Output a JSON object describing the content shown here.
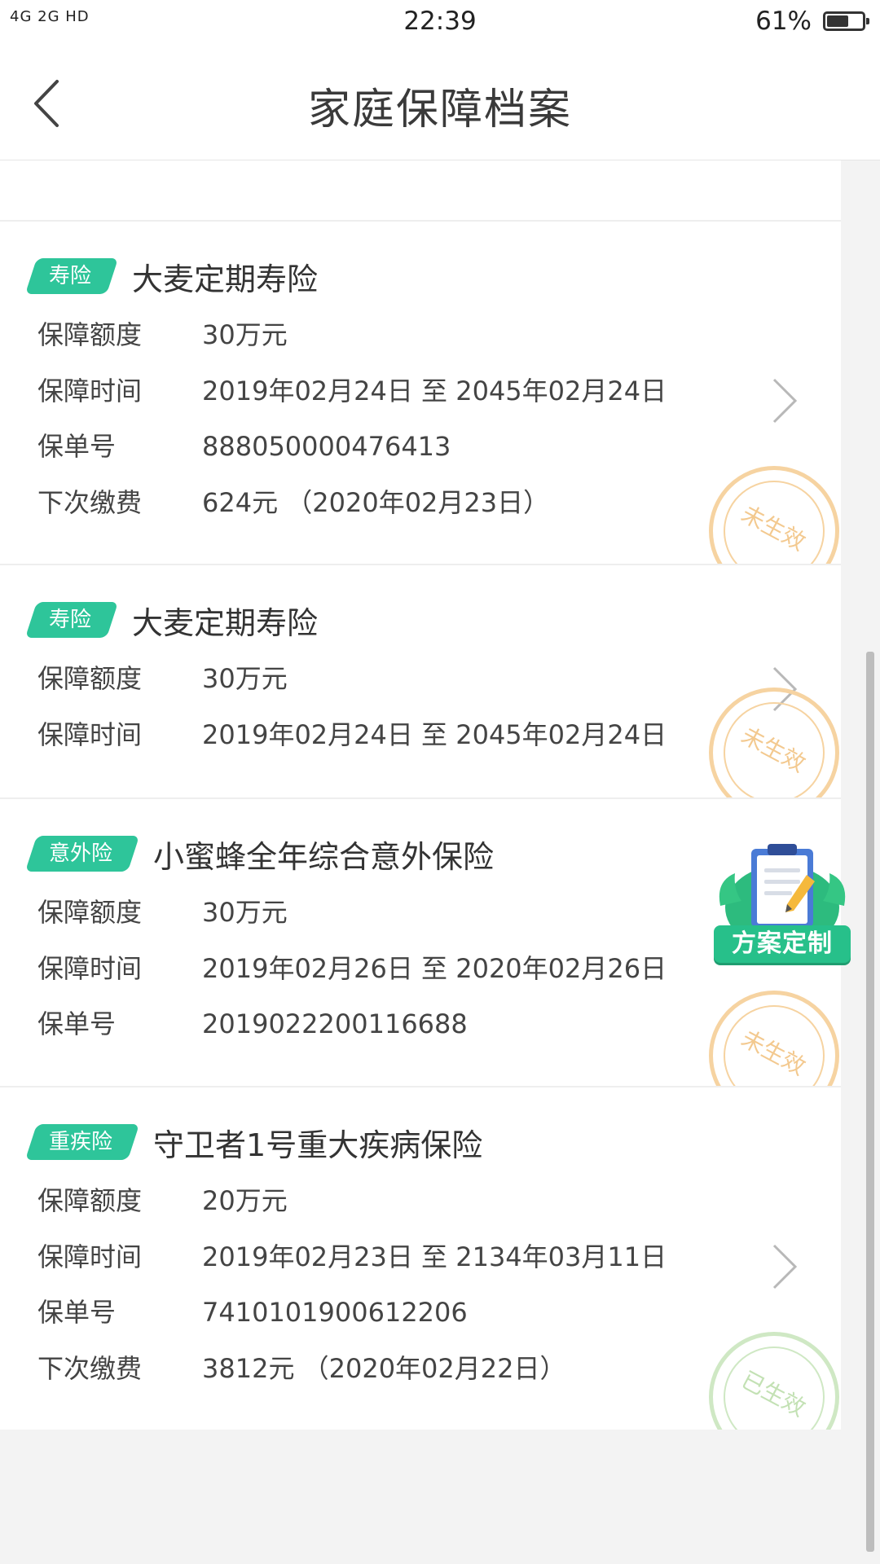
{
  "status_bar": {
    "signals": "4G 2G HD",
    "time": "22:39",
    "battery_pct": "61%",
    "battery_level": 0.61
  },
  "header": {
    "title": "家庭保障档案"
  },
  "policies": [
    {
      "tag": "寿险",
      "name": "大麦定期寿险",
      "rows": [
        {
          "label": "保障额度",
          "value": "30万元"
        },
        {
          "label": "保障时间",
          "value": "2019年02月24日 至 2045年02月24日"
        },
        {
          "label": "保单号",
          "value": "888050000476413"
        },
        {
          "label": "下次缴费",
          "value": "624元 （2020年02月23日）"
        }
      ],
      "status": "未生效"
    },
    {
      "tag": "寿险",
      "name": "大麦定期寿险",
      "rows": [
        {
          "label": "保障额度",
          "value": "30万元"
        },
        {
          "label": "保障时间",
          "value": "2019年02月24日 至 2045年02月24日"
        }
      ],
      "status": "未生效"
    },
    {
      "tag": "意外险",
      "name": "小蜜蜂全年综合意外保险",
      "rows": [
        {
          "label": "保障额度",
          "value": "30万元"
        },
        {
          "label": "保障时间",
          "value": "2019年02月26日 至 2020年02月26日"
        },
        {
          "label": "保单号",
          "value": "2019022200116688"
        }
      ],
      "status": "未生效"
    },
    {
      "tag": "重疾险",
      "name": "守卫者1号重大疾病保险",
      "rows": [
        {
          "label": "保障额度",
          "value": "20万元"
        },
        {
          "label": "保障时间",
          "value": "2019年02月23日 至 2134年03月11日"
        },
        {
          "label": "保单号",
          "value": "7410101900612206"
        },
        {
          "label": "下次缴费",
          "value": "3812元 （2020年02月22日）"
        }
      ],
      "status": "已生效"
    }
  ],
  "fab": {
    "label": "方案定制"
  },
  "colors": {
    "tag": "#2ec59a",
    "stamp_pending": "#f6d3a1",
    "stamp_active": "#cfe8c4"
  }
}
